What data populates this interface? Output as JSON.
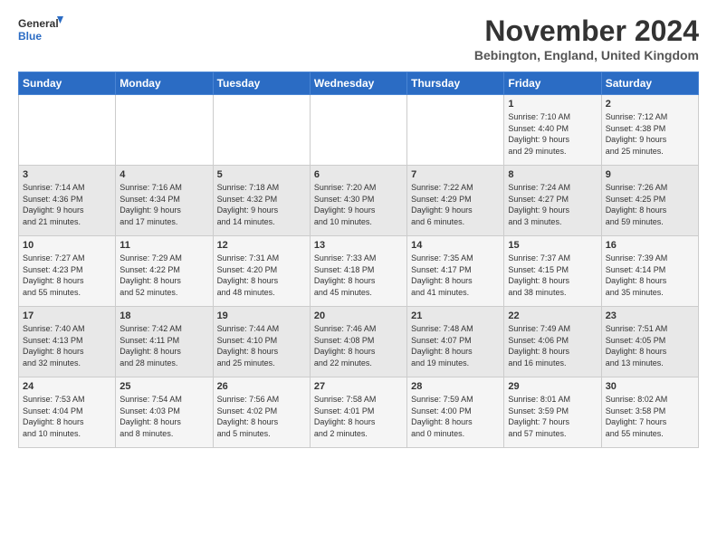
{
  "logo": {
    "line1": "General",
    "line2": "Blue"
  },
  "title": "November 2024",
  "location": "Bebington, England, United Kingdom",
  "days_header": [
    "Sunday",
    "Monday",
    "Tuesday",
    "Wednesday",
    "Thursday",
    "Friday",
    "Saturday"
  ],
  "weeks": [
    [
      {
        "day": "",
        "info": ""
      },
      {
        "day": "",
        "info": ""
      },
      {
        "day": "",
        "info": ""
      },
      {
        "day": "",
        "info": ""
      },
      {
        "day": "",
        "info": ""
      },
      {
        "day": "1",
        "info": "Sunrise: 7:10 AM\nSunset: 4:40 PM\nDaylight: 9 hours\nand 29 minutes."
      },
      {
        "day": "2",
        "info": "Sunrise: 7:12 AM\nSunset: 4:38 PM\nDaylight: 9 hours\nand 25 minutes."
      }
    ],
    [
      {
        "day": "3",
        "info": "Sunrise: 7:14 AM\nSunset: 4:36 PM\nDaylight: 9 hours\nand 21 minutes."
      },
      {
        "day": "4",
        "info": "Sunrise: 7:16 AM\nSunset: 4:34 PM\nDaylight: 9 hours\nand 17 minutes."
      },
      {
        "day": "5",
        "info": "Sunrise: 7:18 AM\nSunset: 4:32 PM\nDaylight: 9 hours\nand 14 minutes."
      },
      {
        "day": "6",
        "info": "Sunrise: 7:20 AM\nSunset: 4:30 PM\nDaylight: 9 hours\nand 10 minutes."
      },
      {
        "day": "7",
        "info": "Sunrise: 7:22 AM\nSunset: 4:29 PM\nDaylight: 9 hours\nand 6 minutes."
      },
      {
        "day": "8",
        "info": "Sunrise: 7:24 AM\nSunset: 4:27 PM\nDaylight: 9 hours\nand 3 minutes."
      },
      {
        "day": "9",
        "info": "Sunrise: 7:26 AM\nSunset: 4:25 PM\nDaylight: 8 hours\nand 59 minutes."
      }
    ],
    [
      {
        "day": "10",
        "info": "Sunrise: 7:27 AM\nSunset: 4:23 PM\nDaylight: 8 hours\nand 55 minutes."
      },
      {
        "day": "11",
        "info": "Sunrise: 7:29 AM\nSunset: 4:22 PM\nDaylight: 8 hours\nand 52 minutes."
      },
      {
        "day": "12",
        "info": "Sunrise: 7:31 AM\nSunset: 4:20 PM\nDaylight: 8 hours\nand 48 minutes."
      },
      {
        "day": "13",
        "info": "Sunrise: 7:33 AM\nSunset: 4:18 PM\nDaylight: 8 hours\nand 45 minutes."
      },
      {
        "day": "14",
        "info": "Sunrise: 7:35 AM\nSunset: 4:17 PM\nDaylight: 8 hours\nand 41 minutes."
      },
      {
        "day": "15",
        "info": "Sunrise: 7:37 AM\nSunset: 4:15 PM\nDaylight: 8 hours\nand 38 minutes."
      },
      {
        "day": "16",
        "info": "Sunrise: 7:39 AM\nSunset: 4:14 PM\nDaylight: 8 hours\nand 35 minutes."
      }
    ],
    [
      {
        "day": "17",
        "info": "Sunrise: 7:40 AM\nSunset: 4:13 PM\nDaylight: 8 hours\nand 32 minutes."
      },
      {
        "day": "18",
        "info": "Sunrise: 7:42 AM\nSunset: 4:11 PM\nDaylight: 8 hours\nand 28 minutes."
      },
      {
        "day": "19",
        "info": "Sunrise: 7:44 AM\nSunset: 4:10 PM\nDaylight: 8 hours\nand 25 minutes."
      },
      {
        "day": "20",
        "info": "Sunrise: 7:46 AM\nSunset: 4:08 PM\nDaylight: 8 hours\nand 22 minutes."
      },
      {
        "day": "21",
        "info": "Sunrise: 7:48 AM\nSunset: 4:07 PM\nDaylight: 8 hours\nand 19 minutes."
      },
      {
        "day": "22",
        "info": "Sunrise: 7:49 AM\nSunset: 4:06 PM\nDaylight: 8 hours\nand 16 minutes."
      },
      {
        "day": "23",
        "info": "Sunrise: 7:51 AM\nSunset: 4:05 PM\nDaylight: 8 hours\nand 13 minutes."
      }
    ],
    [
      {
        "day": "24",
        "info": "Sunrise: 7:53 AM\nSunset: 4:04 PM\nDaylight: 8 hours\nand 10 minutes."
      },
      {
        "day": "25",
        "info": "Sunrise: 7:54 AM\nSunset: 4:03 PM\nDaylight: 8 hours\nand 8 minutes."
      },
      {
        "day": "26",
        "info": "Sunrise: 7:56 AM\nSunset: 4:02 PM\nDaylight: 8 hours\nand 5 minutes."
      },
      {
        "day": "27",
        "info": "Sunrise: 7:58 AM\nSunset: 4:01 PM\nDaylight: 8 hours\nand 2 minutes."
      },
      {
        "day": "28",
        "info": "Sunrise: 7:59 AM\nSunset: 4:00 PM\nDaylight: 8 hours\nand 0 minutes."
      },
      {
        "day": "29",
        "info": "Sunrise: 8:01 AM\nSunset: 3:59 PM\nDaylight: 7 hours\nand 57 minutes."
      },
      {
        "day": "30",
        "info": "Sunrise: 8:02 AM\nSunset: 3:58 PM\nDaylight: 7 hours\nand 55 minutes."
      }
    ]
  ]
}
